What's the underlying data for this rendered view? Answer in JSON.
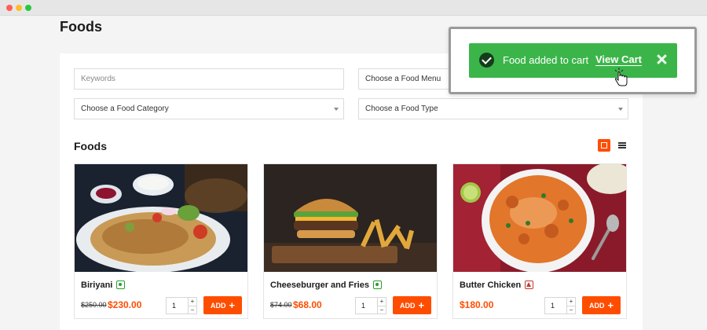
{
  "page": {
    "title": "Foods"
  },
  "filters": {
    "keywords_placeholder": "Keywords",
    "menu_value": "Choose a Food Menu",
    "category_value": "Choose a Food Category",
    "type_value": "Choose a Food Type"
  },
  "section": {
    "title": "Foods"
  },
  "items": [
    {
      "name": "Biriyani",
      "diet": "veg",
      "old_price": "$250.00",
      "price": "$230.00",
      "qty": "1",
      "add_label": "ADD"
    },
    {
      "name": "Cheeseburger and Fries",
      "diet": "veg",
      "old_price": "$74.00",
      "price": "$68.00",
      "qty": "1",
      "add_label": "ADD"
    },
    {
      "name": "Butter Chicken",
      "diet": "non-veg",
      "old_price": "",
      "price": "$180.00",
      "qty": "1",
      "add_label": "ADD"
    }
  ],
  "toast": {
    "message": "Food added to cart",
    "link_label": "View Cart"
  },
  "colors": {
    "accent": "#ff4d00",
    "toast_bg": "#3bb54a",
    "veg": "#2a9d2a",
    "nonveg": "#c0392b"
  }
}
